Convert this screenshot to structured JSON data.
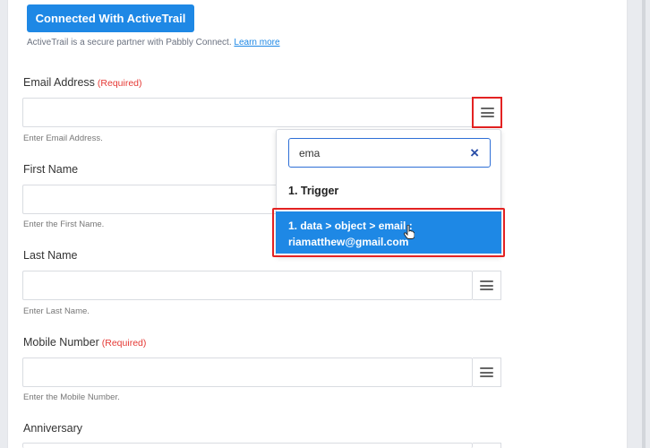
{
  "connection": {
    "button_label": "Connected With ActiveTrail",
    "partner_text": "ActiveTrail is a secure partner with Pabbly Connect.",
    "learn_more": "Learn more"
  },
  "fields": [
    {
      "label": "Email Address",
      "required": "(Required)",
      "help": "Enter Email Address.",
      "value": ""
    },
    {
      "label": "First Name",
      "required": "",
      "help": "Enter the First Name.",
      "value": ""
    },
    {
      "label": "Last Name",
      "required": "",
      "help": "Enter Last Name.",
      "value": ""
    },
    {
      "label": "Mobile Number",
      "required": "(Required)",
      "help": "Enter the Mobile Number.",
      "value": ""
    },
    {
      "label": "Anniversary",
      "required": "",
      "help": "",
      "value": ""
    }
  ],
  "dropdown": {
    "search_value": "ema",
    "clear_symbol": "×",
    "group_label": "1. Trigger",
    "option_line1": "1. data > object > email :",
    "option_line2": "riamatthew@gmail.com"
  },
  "icons": {
    "menu": "hamburger-menu-icon",
    "clear": "close-icon",
    "cursor": "hand-pointer-icon"
  },
  "colors": {
    "primary": "#1e88e5",
    "required": "#e53935",
    "highlight": "#e32222"
  }
}
